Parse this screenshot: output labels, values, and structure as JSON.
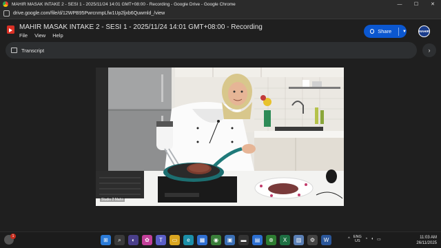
{
  "browser": {
    "window_title": "MAHIR MASAK INTAKE 2 - SESI 1 - 2025/11/24 14:01 GMT+08:00 - Recording - Google Drive - Google Chrome",
    "url": "drive.google.com/file/d/12WPB95PwrcnmpLfw1Up2ljxb6Quwmld_/view",
    "controls": {
      "minimize": "—",
      "maximize": "☐",
      "close": "✕"
    }
  },
  "drive": {
    "file_title": "MAHIR MASAK INTAKE 2 - SESI 1 - 2025/11/24 14:01 GMT+08:00 - Recording",
    "menu": [
      "File",
      "View",
      "Help"
    ],
    "share_label": "Share",
    "avatar_text": "MAHIR",
    "transcript_label": "Transcript"
  },
  "video": {
    "participant_label": "Studio 2 Mahir"
  },
  "taskbar": {
    "notification_count": "1",
    "apps": [
      {
        "name": "start-icon",
        "glyph": "⊞",
        "color": "#2b7bd8"
      },
      {
        "name": "search-icon",
        "glyph": "⌕",
        "color": "#3a3a3a"
      },
      {
        "name": "copilot-icon",
        "glyph": "◐",
        "color": "#4a3f8a"
      },
      {
        "name": "colorful-app-icon",
        "glyph": "✿",
        "color": "#c2409a"
      },
      {
        "name": "teams-icon",
        "glyph": "T",
        "color": "#5b5fc7"
      },
      {
        "name": "file-explorer-icon",
        "glyph": "▭",
        "color": "#d9a520"
      },
      {
        "name": "edge-icon",
        "glyph": "e",
        "color": "#1b8fa8"
      },
      {
        "name": "store-icon",
        "glyph": "▦",
        "color": "#2f6fd1"
      },
      {
        "name": "chrome-icon",
        "glyph": "◉",
        "color": "#3a7f3a"
      },
      {
        "name": "photos-icon",
        "glyph": "▣",
        "color": "#3a6fb5"
      },
      {
        "name": "terminal-icon",
        "glyph": "▬",
        "color": "#333333"
      },
      {
        "name": "calculator-icon",
        "glyph": "▤",
        "color": "#2c6fd1"
      },
      {
        "name": "xbox-icon",
        "glyph": "⊛",
        "color": "#2e7d32"
      },
      {
        "name": "excel-icon",
        "glyph": "X",
        "color": "#1d6f42"
      },
      {
        "name": "files-icon",
        "glyph": "▥",
        "color": "#5a7fb5"
      },
      {
        "name": "settings-icon",
        "glyph": "⚙",
        "color": "#444444"
      },
      {
        "name": "word-icon",
        "glyph": "W",
        "color": "#2b579a"
      }
    ],
    "tray": {
      "chevron": "^",
      "lang_top": "ENG",
      "lang_bottom": "US"
    },
    "time": "11:03 AM",
    "date": "26/11/2025"
  }
}
